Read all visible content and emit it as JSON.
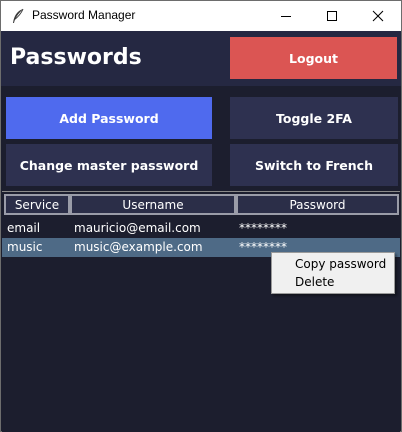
{
  "window": {
    "title": "Password Manager",
    "icons": {
      "app": "feather-icon",
      "minimize": "minimize-icon",
      "maximize": "maximize-icon",
      "close": "close-icon"
    }
  },
  "header": {
    "title": "Passwords",
    "logout_label": "Logout"
  },
  "actions": {
    "add_password": "Add Password",
    "toggle_2fa": "Toggle 2FA",
    "change_master": "Change master password",
    "switch_language": "Switch to French"
  },
  "table": {
    "columns": [
      "Service",
      "Username",
      "Password"
    ],
    "rows": [
      {
        "service": "email",
        "username": "mauricio@email.com",
        "password": "********"
      },
      {
        "service": "music",
        "username": "music@example.com",
        "password": "********"
      }
    ],
    "selected_row": 1
  },
  "context_menu": {
    "items": [
      "Copy password",
      "Delete"
    ]
  },
  "colors": {
    "background": "#1c1e2e",
    "header": "#252842",
    "primary": "#4f6aee",
    "danger": "#db5553",
    "button": "#2e3150",
    "selection": "#4e6a86"
  }
}
